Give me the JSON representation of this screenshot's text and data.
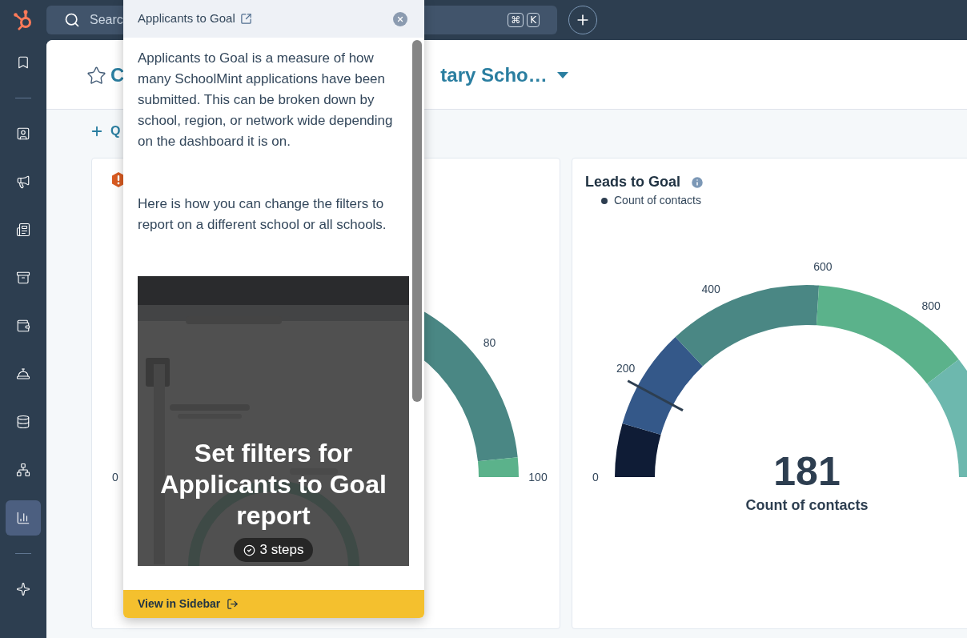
{
  "top_bar": {
    "search": {
      "placeholder": "Searc"
    },
    "shortcut_keys": [
      "⌘",
      "K"
    ]
  },
  "sidebar": {
    "groups": [
      [
        {
          "kind": "bookmark",
          "selected": false
        }
      ],
      [
        {
          "kind": "contacts",
          "selected": false
        },
        {
          "kind": "megaphone",
          "selected": false
        },
        {
          "kind": "newspaper",
          "selected": false
        },
        {
          "kind": "archive",
          "selected": false
        },
        {
          "kind": "wallet",
          "selected": false
        },
        {
          "kind": "bell",
          "selected": false
        },
        {
          "kind": "database",
          "selected": false
        },
        {
          "kind": "network",
          "selected": false
        },
        {
          "kind": "chart",
          "selected": true
        }
      ],
      [
        {
          "kind": "sparkle",
          "selected": false
        }
      ]
    ]
  },
  "dashboard": {
    "title_start": "C",
    "title_end": "tary Scho…",
    "quick_filter_label": "Q"
  },
  "cards": [
    {
      "warning": true,
      "gauge": {
        "segments": [
          {
            "color": "#4a8784"
          },
          {
            "color": "#5bb28b"
          }
        ],
        "ticks": [
          "0",
          "80",
          "100"
        ]
      }
    },
    {
      "warning": false,
      "title": "Leads to Goal",
      "legend": "Count of contacts",
      "gauge": {
        "level": 0.157,
        "value": "181",
        "value_label": "Count of contacts",
        "segments": [
          {
            "color": "#0f1c36"
          },
          {
            "color": "#345889"
          },
          {
            "color": "#4a8784"
          },
          {
            "color": "#5bb28b"
          },
          {
            "color": "#6db8ae"
          }
        ],
        "ticks": [
          "0",
          "200",
          "400",
          "600",
          "800"
        ]
      }
    }
  ],
  "popover": {
    "title": "Applicants to Goal",
    "paragraphs": [
      "Applicants to Goal is a measure of how many SchoolMint applications have been submitted. This can be broken down by school, region, or network wide depending on the dashboard it is on.",
      "Here is how you can change the filters to report on a different school or all schools."
    ],
    "media": {
      "kind": "picture",
      "title": "Set filters for Applicants to Goal report",
      "steps": "3 steps"
    },
    "footer_button": "View in Sidebar"
  }
}
